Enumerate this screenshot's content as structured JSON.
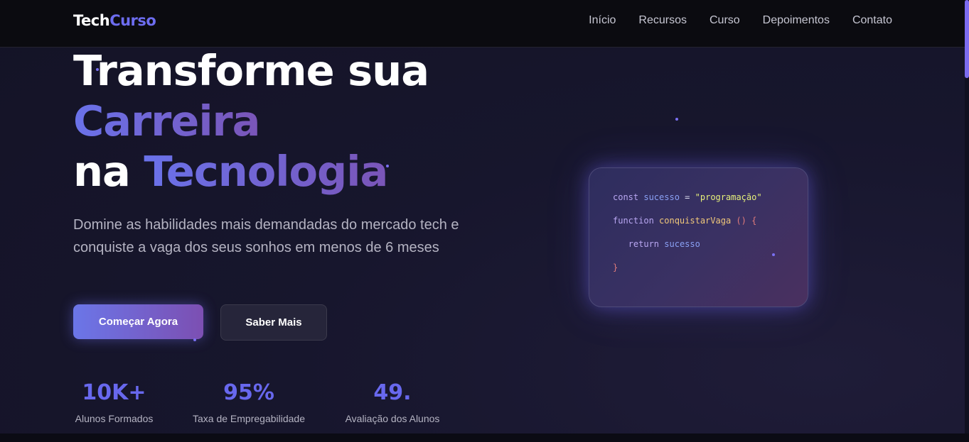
{
  "logo": {
    "part1": "Tech",
    "part2": "Curso"
  },
  "nav": {
    "items": [
      {
        "label": "Início"
      },
      {
        "label": "Recursos"
      },
      {
        "label": "Curso"
      },
      {
        "label": "Depoimentos"
      },
      {
        "label": "Contato"
      }
    ]
  },
  "hero": {
    "line1": "Transforme sua",
    "line2": "Carreira",
    "line3_prefix": "na ",
    "line3_highlight": "Tecnologia",
    "subtitle": "Domine as habilidades mais demandadas do mercado tech e conquiste a vaga dos seus sonhos em menos de 6 meses",
    "cta_primary": "Começar Agora",
    "cta_secondary": "Saber Mais"
  },
  "stats": [
    {
      "value": "10K+",
      "label": "Alunos Formados"
    },
    {
      "value": "95%",
      "label": "Taxa de Empregabilidade"
    },
    {
      "value": "49.",
      "label": "Avaliação dos Alunos"
    }
  ],
  "code": {
    "line1": {
      "kw": "const",
      "var": "sucesso",
      "op": "=",
      "str": "\"programação\""
    },
    "line2": {
      "kw": "function",
      "fn": "conquistarVaga",
      "punc": "() {"
    },
    "line3": {
      "indent": "   ",
      "kw": "return",
      "var": "sucesso"
    },
    "line4": {
      "punc": "}"
    }
  },
  "colors": {
    "accent": "#6d6df0",
    "gradient_start": "#6a72ea",
    "gradient_end": "#7a55b8",
    "background": "#15142a",
    "navbar": "#0b0b10"
  }
}
